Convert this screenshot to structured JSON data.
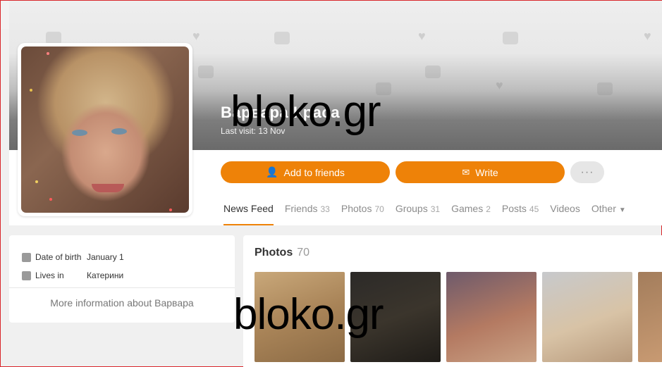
{
  "profile": {
    "name": "Варвара Краса",
    "last_visit": "Last visit: 13 Nov"
  },
  "actions": {
    "add_friends": "Add to friends",
    "write": "Write",
    "more": "···"
  },
  "nav": {
    "items": [
      {
        "label": "News Feed",
        "count": ""
      },
      {
        "label": "Friends",
        "count": "33"
      },
      {
        "label": "Photos",
        "count": "70"
      },
      {
        "label": "Groups",
        "count": "31"
      },
      {
        "label": "Games",
        "count": "2"
      },
      {
        "label": "Posts",
        "count": "45"
      },
      {
        "label": "Videos",
        "count": ""
      },
      {
        "label": "Other",
        "count": ""
      }
    ]
  },
  "info": {
    "birth_label": "Date of birth",
    "birth_value": "January 1",
    "lives_label": "Lives in",
    "lives_value": "Катерини",
    "more": "More information about Варвара"
  },
  "photos": {
    "title": "Photos",
    "count": "70"
  },
  "watermarks": [
    "bloko.gr",
    "bloko.gr"
  ],
  "colors": {
    "accent": "#ee8208",
    "page_bg": "#f0f0f0"
  }
}
